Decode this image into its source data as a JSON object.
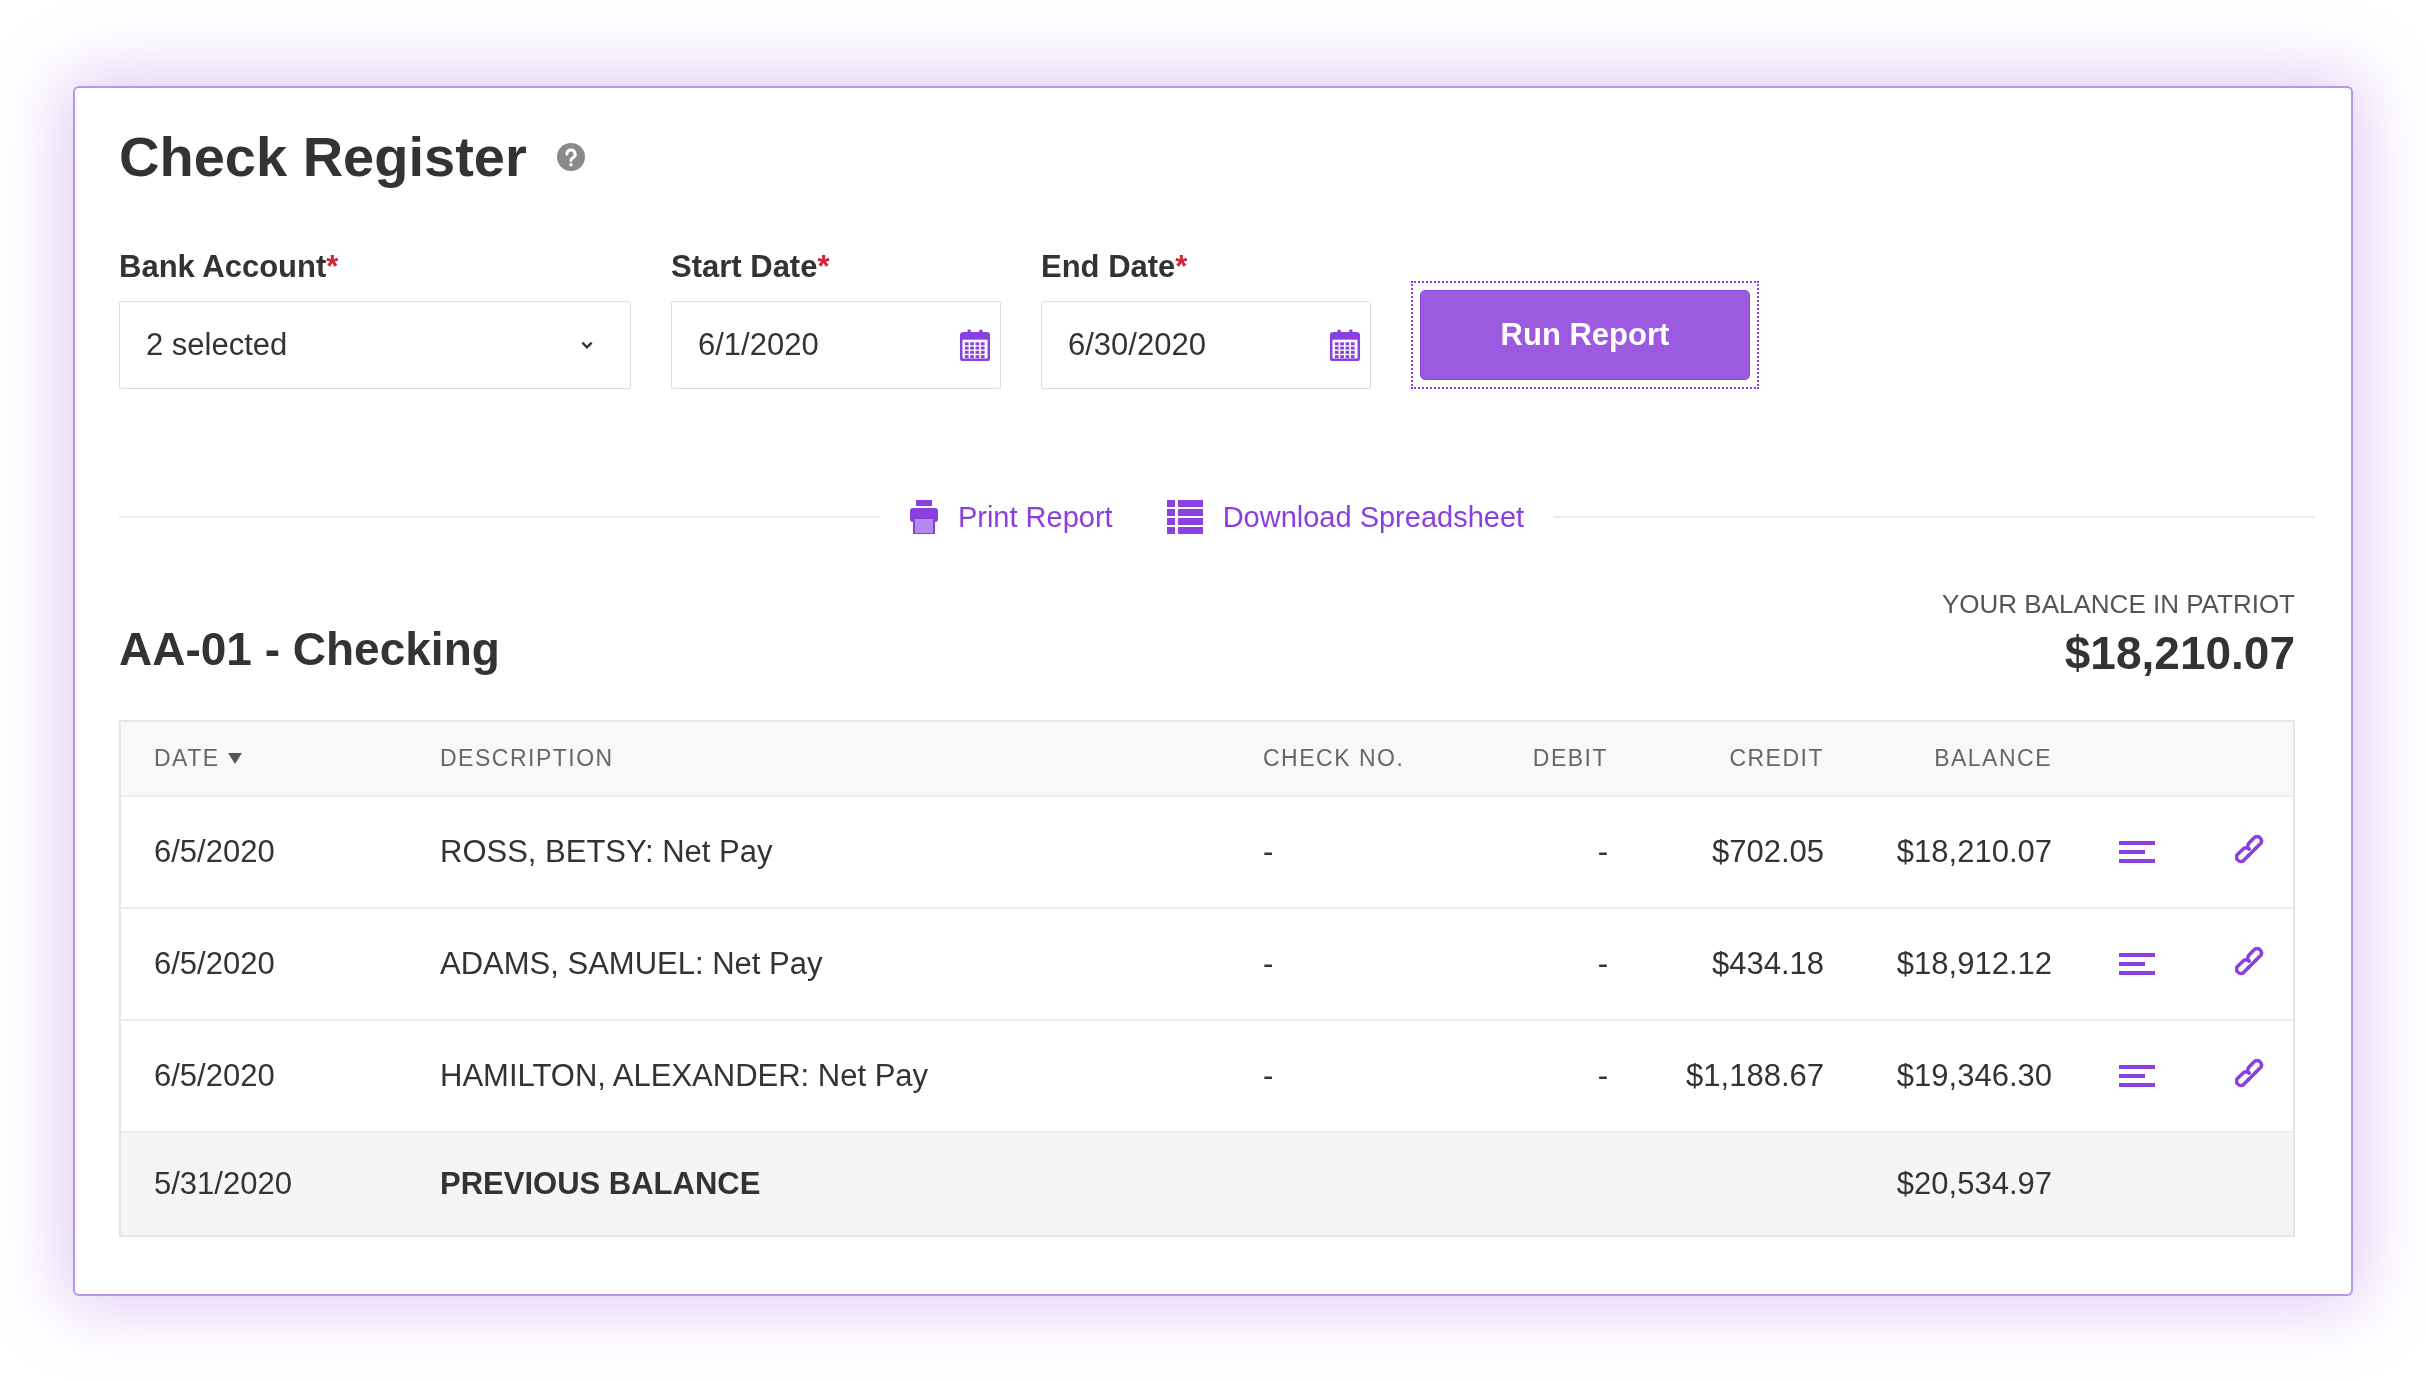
{
  "title": "Check Register",
  "filters": [
    {
      "kind": "select",
      "label": "Bank Account",
      "required_mark": "*",
      "value": "2 selected"
    },
    {
      "kind": "date",
      "label": "Start Date",
      "required_mark": "*",
      "value": "6/1/2020"
    },
    {
      "kind": "date",
      "label": "End Date",
      "required_mark": "*",
      "value": "6/30/2020"
    }
  ],
  "run_button": {
    "label": "Run Report",
    "focused": true
  },
  "actions": [
    {
      "kind": "print",
      "label": "Print Report"
    },
    {
      "kind": "spreadsheet",
      "label": "Download Spreadsheet"
    }
  ],
  "account": {
    "name": "AA-01 - Checking",
    "balance_label": "YOUR BALANCE IN PATRIOT",
    "balance": "$18,210.07"
  },
  "table": {
    "columns": [
      {
        "label": "DATE",
        "sorted": true
      },
      {
        "label": "DESCRIPTION",
        "sorted": false
      },
      {
        "label": "CHECK NO.",
        "sorted": false
      },
      {
        "label": "DEBIT",
        "sorted": false
      },
      {
        "label": "CREDIT",
        "sorted": false
      },
      {
        "label": "BALANCE",
        "sorted": false
      }
    ],
    "rows": [
      {
        "kind": "transaction",
        "date": "6/5/2020",
        "description": "ROSS, BETSY: Net Pay",
        "check_no": "-",
        "debit": "-",
        "credit": "$702.05",
        "balance": "$18,210.07"
      },
      {
        "kind": "transaction",
        "date": "6/5/2020",
        "description": "ADAMS, SAMUEL: Net Pay",
        "check_no": "-",
        "debit": "-",
        "credit": "$434.18",
        "balance": "$18,912.12"
      },
      {
        "kind": "transaction",
        "date": "6/5/2020",
        "description": "HAMILTON, ALEXANDER: Net Pay",
        "check_no": "-",
        "debit": "-",
        "credit": "$1,188.67",
        "balance": "$19,346.30"
      },
      {
        "kind": "previous_balance",
        "date": "5/31/2020",
        "description": "PREVIOUS BALANCE",
        "balance": "$20,534.97"
      }
    ]
  }
}
